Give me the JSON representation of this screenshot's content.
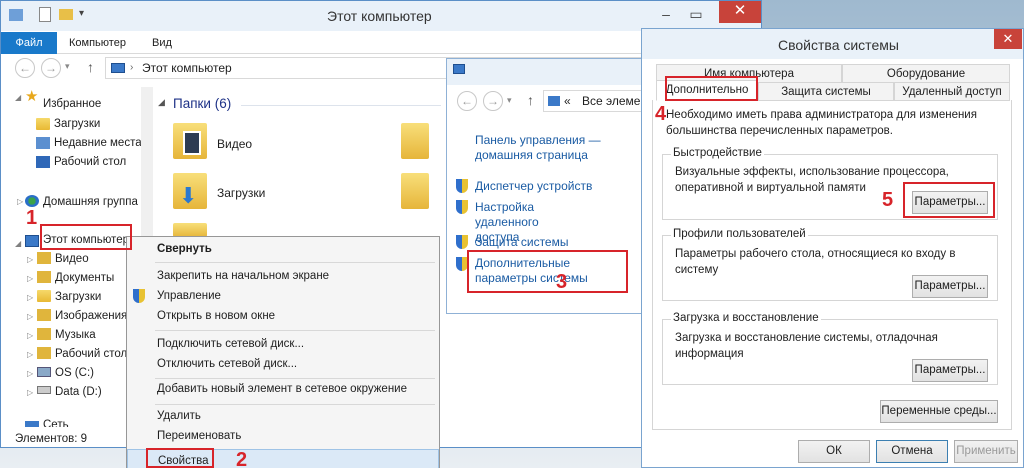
{
  "explorer": {
    "title": "Этот компьютер",
    "ribbon_tabs": [
      "Файл",
      "Компьютер",
      "Вид"
    ],
    "address_path": "Этот компьютер",
    "sidebar": {
      "favorites": "Избранное",
      "downloads": "Загрузки",
      "recent": "Недавние места",
      "desktop": "Рабочий стол",
      "homegroup": "Домашняя группа",
      "this_pc": "Этот компьютер",
      "children": [
        "Видео",
        "Документы",
        "Загрузки",
        "Изображения",
        "Музыка",
        "Рабочий стол",
        "OS (C:)",
        "Data (D:)"
      ],
      "network": "Сеть"
    },
    "folders_header": "Папки (6)",
    "folders": [
      "Видео",
      "Загрузки"
    ],
    "status": "Элементов: 9"
  },
  "context_menu": {
    "items": [
      "Свернуть",
      "Закрепить на начальном экране",
      "Управление",
      "Открыть в новом окне",
      "Подключить сетевой диск...",
      "Отключить сетевой диск...",
      "Добавить новый элемент в сетевое окружение",
      "Удалить",
      "Переименовать",
      "Свойства"
    ]
  },
  "control_panel": {
    "address": "Все элементы",
    "address_prefix": "«",
    "home_link": "Панель управления — домашняя страница",
    "links": [
      "Диспетчер устройств",
      "Настройка удаленного доступа",
      "Защита системы",
      "Дополнительные параметры системы"
    ]
  },
  "dialog": {
    "title": "Свойства системы",
    "tabs_back": [
      "Имя компьютера",
      "Оборудование"
    ],
    "tabs_front": [
      "Дополнительно",
      "Защита системы",
      "Удаленный доступ"
    ],
    "admin_note": "Необходимо иметь права администратора для изменения большинства перечисленных параметров.",
    "performance": {
      "legend": "Быстродействие",
      "text": "Визуальные эффекты, использование процессора, оперативной и виртуальной памяти",
      "button": "Параметры..."
    },
    "profiles": {
      "legend": "Профили пользователей",
      "text": "Параметры рабочего стола, относящиеся ко входу в систему",
      "button": "Параметры..."
    },
    "startup": {
      "legend": "Загрузка и восстановление",
      "text": "Загрузка и восстановление системы, отладочная информация",
      "button": "Параметры..."
    },
    "env_button": "Переменные среды...",
    "ok": "ОК",
    "cancel": "Отмена",
    "apply": "Применить"
  },
  "callouts": [
    "1",
    "2",
    "3",
    "4",
    "5"
  ],
  "colors": {
    "accent": "#1979ca",
    "annotation": "#d7242a",
    "close": "#c8433a",
    "link": "#1a5ba3"
  }
}
